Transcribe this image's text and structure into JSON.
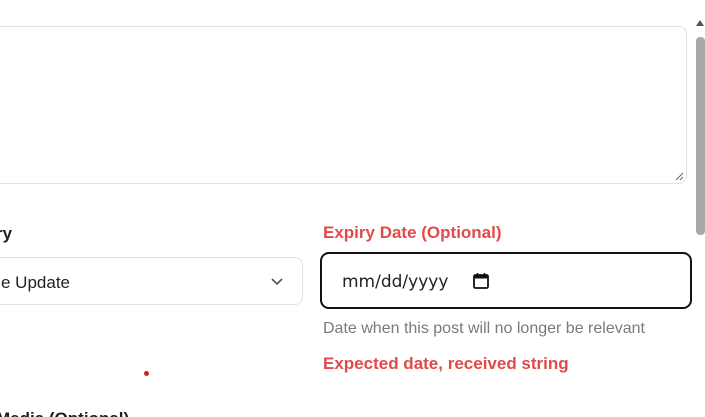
{
  "form": {
    "category": {
      "label": "ry",
      "value": "e Update"
    },
    "expiry": {
      "label": "Expiry Date (Optional)",
      "placeholder": "mm/dd/yyyy",
      "help": "Date when this post will no longer be relevant",
      "error": "Expected date, received string"
    },
    "next_field_label": "Media (Optional)"
  },
  "colors": {
    "error": "#e24a4a",
    "focus_border": "#111111",
    "border": "#e2e2e2",
    "help_text": "#7a7a7a"
  },
  "icons": {
    "select_chevron": "chevron-down-icon",
    "date_picker": "calendar-icon",
    "resize": "resize-grip-icon"
  }
}
